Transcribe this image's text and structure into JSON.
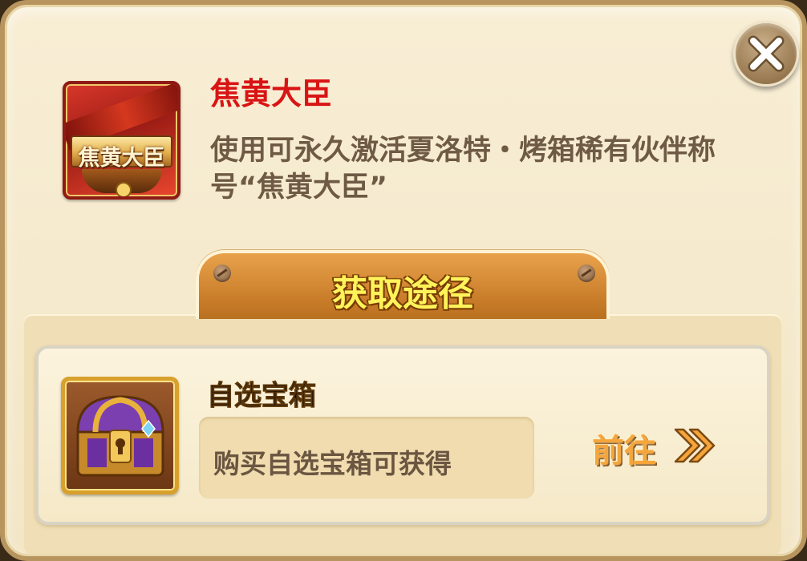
{
  "item": {
    "name": "焦黄大臣",
    "icon_label": "焦黄大臣",
    "description": "使用可永久激活夏洛特・烤箱稀有伙伴称号“焦黄大臣”",
    "name_color": "#d91414"
  },
  "section": {
    "title": "获取途径"
  },
  "sources": [
    {
      "name": "自选宝箱",
      "description": "购买自选宝箱可获得",
      "action_label": "前往",
      "icon": "treasure-chest-icon"
    }
  ],
  "icons": {
    "close": "close-icon",
    "goto_arrow": "double-chevron-right-icon"
  }
}
